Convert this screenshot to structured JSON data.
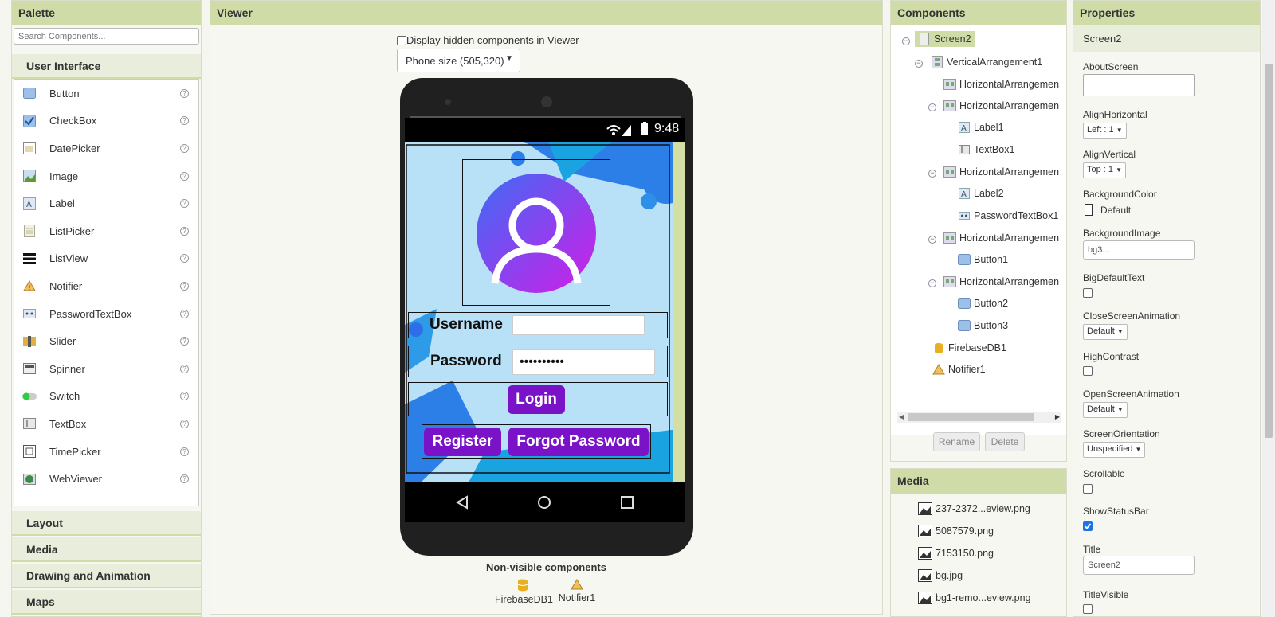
{
  "palette": {
    "title": "Palette",
    "search_placeholder": "Search Components...",
    "open_category": "User Interface",
    "items": [
      {
        "label": "Button",
        "icon": "button-icon"
      },
      {
        "label": "CheckBox",
        "icon": "checkbox-icon"
      },
      {
        "label": "DatePicker",
        "icon": "datepicker-icon"
      },
      {
        "label": "Image",
        "icon": "image-icon"
      },
      {
        "label": "Label",
        "icon": "label-icon"
      },
      {
        "label": "ListPicker",
        "icon": "listpicker-icon"
      },
      {
        "label": "ListView",
        "icon": "listview-icon"
      },
      {
        "label": "Notifier",
        "icon": "notifier-icon"
      },
      {
        "label": "PasswordTextBox",
        "icon": "passwordtextbox-icon"
      },
      {
        "label": "Slider",
        "icon": "slider-icon"
      },
      {
        "label": "Spinner",
        "icon": "spinner-icon"
      },
      {
        "label": "Switch",
        "icon": "switch-icon"
      },
      {
        "label": "TextBox",
        "icon": "textbox-icon"
      },
      {
        "label": "TimePicker",
        "icon": "timepicker-icon"
      },
      {
        "label": "WebViewer",
        "icon": "webviewer-icon"
      }
    ],
    "help_glyph": "?",
    "categories": [
      "Layout",
      "Media",
      "Drawing and Animation",
      "Maps"
    ]
  },
  "viewer": {
    "title": "Viewer",
    "hidden_checkbox_label": "Display hidden components in Viewer",
    "size_select": "Phone size (505,320)",
    "status_time": "9:48",
    "username_label": "Username",
    "password_label": "Password",
    "password_value": "••••••••••",
    "login_label": "Login",
    "register_label": "Register",
    "forgot_label": "Forgot Password",
    "nonvisible_title": "Non-visible components",
    "nonvisible": [
      "FirebaseDB1",
      "Notifier1"
    ]
  },
  "components": {
    "title": "Components",
    "tree": [
      {
        "label": "Screen2",
        "icon": "screen-icon"
      },
      {
        "label": "VerticalArrangement1",
        "icon": "vertical-arrangement-icon"
      },
      {
        "label": "HorizontalArrangemen",
        "icon": "horizontal-arrangement-icon"
      },
      {
        "label": "HorizontalArrangemen",
        "icon": "horizontal-arrangement-icon"
      },
      {
        "label": "Label1",
        "icon": "label-icon"
      },
      {
        "label": "TextBox1",
        "icon": "textbox-icon"
      },
      {
        "label": "HorizontalArrangemen",
        "icon": "horizontal-arrangement-icon"
      },
      {
        "label": "Label2",
        "icon": "label-icon"
      },
      {
        "label": "PasswordTextBox1",
        "icon": "passwordtextbox-icon"
      },
      {
        "label": "HorizontalArrangemen",
        "icon": "horizontal-arrangement-icon"
      },
      {
        "label": "Button1",
        "icon": "button-icon"
      },
      {
        "label": "HorizontalArrangemen",
        "icon": "horizontal-arrangement-icon"
      },
      {
        "label": "Button2",
        "icon": "button-icon"
      },
      {
        "label": "Button3",
        "icon": "button-icon"
      },
      {
        "label": "FirebaseDB1",
        "icon": "firebase-icon"
      },
      {
        "label": "Notifier1",
        "icon": "notifier-icon"
      }
    ],
    "rename_label": "Rename",
    "delete_label": "Delete"
  },
  "media": {
    "title": "Media",
    "files": [
      "237-2372...eview.png",
      "5087579.png",
      "7153150.png",
      "bg.jpg",
      "bg1-remo...eview.png"
    ]
  },
  "properties": {
    "title": "Properties",
    "component": "Screen2",
    "about_label": "AboutScreen",
    "align_h_label": "AlignHorizontal",
    "align_h_value": "Left : 1",
    "align_v_label": "AlignVertical",
    "align_v_value": "Top : 1",
    "bg_color_label": "BackgroundColor",
    "bg_color_value": "Default",
    "bg_image_label": "BackgroundImage",
    "bg_image_value": "bg3...",
    "big_text_label": "BigDefaultText",
    "close_anim_label": "CloseScreenAnimation",
    "close_anim_value": "Default",
    "high_contrast_label": "HighContrast",
    "open_anim_label": "OpenScreenAnimation",
    "open_anim_value": "Default",
    "orientation_label": "ScreenOrientation",
    "orientation_value": "Unspecified",
    "scrollable_label": "Scrollable",
    "status_bar_label": "ShowStatusBar",
    "title_label": "Title",
    "title_value": "Screen2",
    "title_visible_label": "TitleVisible"
  },
  "colors": {
    "accent": "#7a13c8",
    "header": "#cfdca8"
  }
}
